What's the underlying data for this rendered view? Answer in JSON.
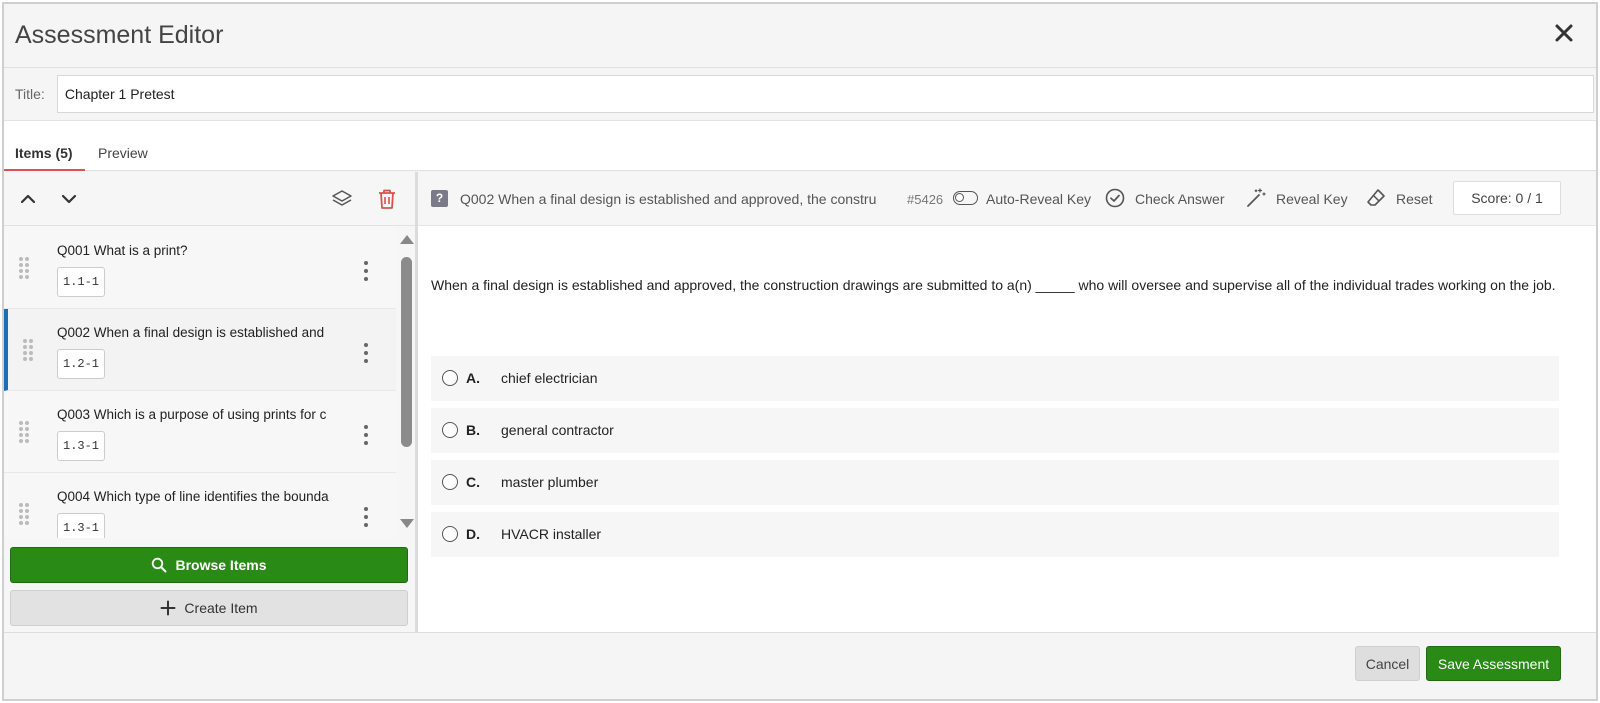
{
  "window": {
    "title": "Assessment Editor",
    "close_icon": "close-icon"
  },
  "title_field": {
    "label": "Title:",
    "value": "Chapter 1 Pretest"
  },
  "tabs": [
    {
      "label": "Items (5)",
      "active": true
    },
    {
      "label": "Preview",
      "active": false
    }
  ],
  "left_toolbar": {
    "icons": [
      "chevron-up-icon",
      "chevron-down-icon",
      "layers-icon",
      "trash-icon"
    ]
  },
  "items": [
    {
      "title": "Q001 What is a print?",
      "code": "1.1-1",
      "selected": false
    },
    {
      "title": "Q002 When a final design is established and",
      "code": "1.2-1",
      "selected": true
    },
    {
      "title": "Q003 Which is a purpose of using prints for c",
      "code": "1.3-1",
      "selected": false
    },
    {
      "title": "Q004 Which type of line identifies the bounda",
      "code": "1.3-1",
      "selected": false
    }
  ],
  "buttons": {
    "browse": "Browse Items",
    "create": "Create Item",
    "cancel": "Cancel",
    "save": "Save Assessment"
  },
  "question_toolbar": {
    "badge": "?",
    "title": "Q002 When a final design is established and approved, the constru",
    "id": "#5426",
    "auto_reveal": "Auto-Reveal Key",
    "check_answer": "Check Answer",
    "reveal_key": "Reveal Key",
    "reset": "Reset",
    "score": "Score: 0 / 1"
  },
  "question": {
    "stem": "When a final design is established and approved, the construction drawings are submitted to a(n) _____ who will oversee and supervise all of the individual trades working on the job.",
    "options": [
      {
        "letter": "A.",
        "text": "chief electrician"
      },
      {
        "letter": "B.",
        "text": "general contractor"
      },
      {
        "letter": "C.",
        "text": "master plumber"
      },
      {
        "letter": "D.",
        "text": "HVACR installer"
      }
    ]
  },
  "colors": {
    "primary_green": "#2a8a16",
    "selected_bar": "#1a6fb5",
    "tab_underline": "#d9534f",
    "delete_red": "#d9534f"
  }
}
